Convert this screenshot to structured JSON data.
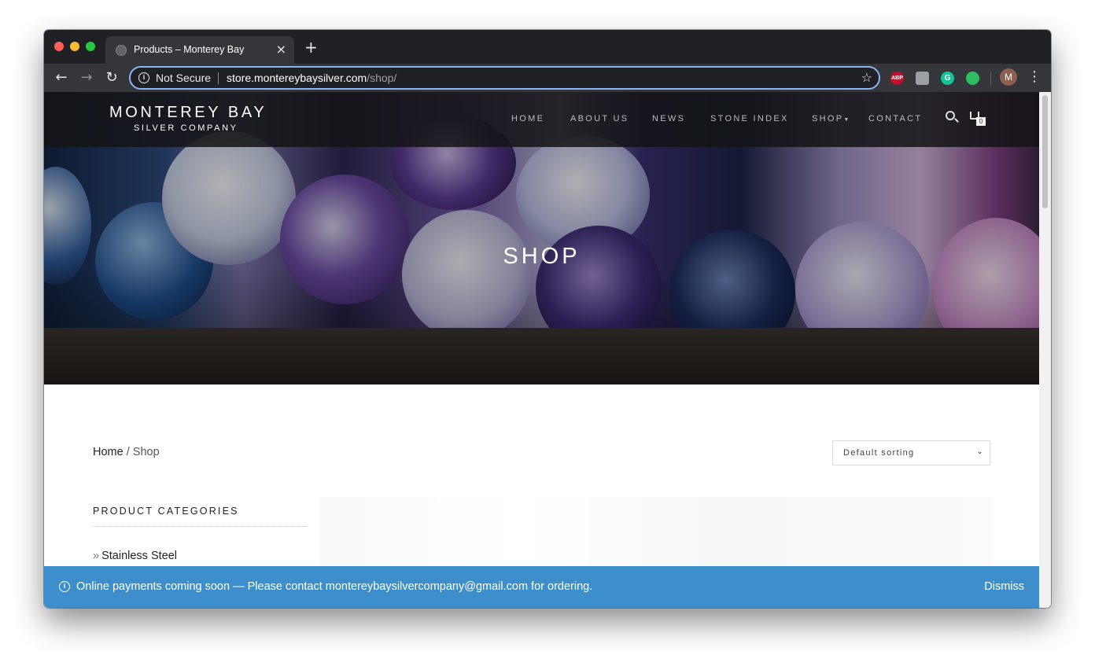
{
  "browser": {
    "tab_title": "Products – Monterey Bay",
    "security_label": "Not Secure",
    "url_host": "store.montereybaysilver.com",
    "url_path": "/shop/",
    "new_tab_symbol": "+",
    "tab_close_symbol": "×",
    "avatar_initial": "M",
    "extensions": [
      "ABP",
      "",
      "G",
      ""
    ]
  },
  "site": {
    "logo_main": "MONTEREY BAY",
    "logo_sub": "SILVER COMPANY",
    "nav": [
      "HOME",
      "ABOUT US",
      "NEWS",
      "STONE INDEX",
      "SHOP",
      "CONTACT"
    ],
    "cart_count": "0"
  },
  "hero": {
    "title": "SHOP"
  },
  "breadcrumb": {
    "home": "Home",
    "separator": " / ",
    "current": "Shop"
  },
  "sorting": {
    "selected": "Default sorting"
  },
  "sidebar": {
    "title": "PRODUCT CATEGORIES",
    "categories": [
      "Stainless Steel"
    ]
  },
  "notice": {
    "text": "Online payments coming soon — Please contact montereybaysilvercompany@gmail.com for ordering.",
    "dismiss": "Dismiss"
  },
  "colors": {
    "notice_bg": "#3d8fcb",
    "header_bg": "#141416",
    "omnibox_focus": "#8ab4f8"
  }
}
